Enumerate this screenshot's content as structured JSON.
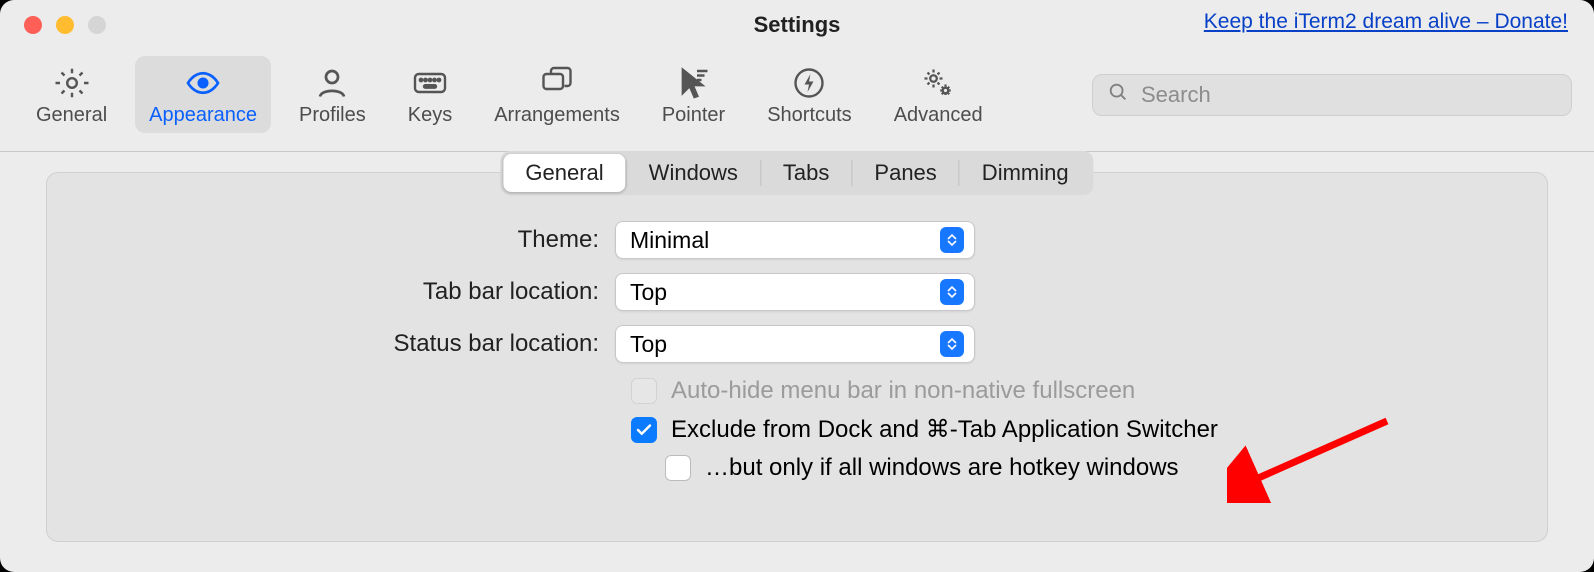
{
  "window": {
    "title": "Settings"
  },
  "donate_link": "Keep the iTerm2 dream alive – Donate!",
  "toolbar": {
    "items": [
      {
        "label": "General"
      },
      {
        "label": "Appearance"
      },
      {
        "label": "Profiles"
      },
      {
        "label": "Keys"
      },
      {
        "label": "Arrangements"
      },
      {
        "label": "Pointer"
      },
      {
        "label": "Shortcuts"
      },
      {
        "label": "Advanced"
      }
    ],
    "selected": "Appearance"
  },
  "search": {
    "placeholder": "Search"
  },
  "subtabs": {
    "items": [
      "General",
      "Windows",
      "Tabs",
      "Panes",
      "Dimming"
    ],
    "active": "General"
  },
  "form": {
    "theme": {
      "label": "Theme:",
      "value": "Minimal"
    },
    "tab_bar_location": {
      "label": "Tab bar location:",
      "value": "Top"
    },
    "status_bar_location": {
      "label": "Status bar location:",
      "value": "Top"
    }
  },
  "checks": {
    "autohide": {
      "label": "Auto-hide menu bar in non-native fullscreen",
      "checked": false,
      "enabled": false
    },
    "exclude": {
      "label": "Exclude from Dock and ⌘-Tab Application Switcher",
      "checked": true,
      "enabled": true
    },
    "hotkey": {
      "label": "…but only if all windows are hotkey windows",
      "checked": false,
      "enabled": true
    }
  }
}
